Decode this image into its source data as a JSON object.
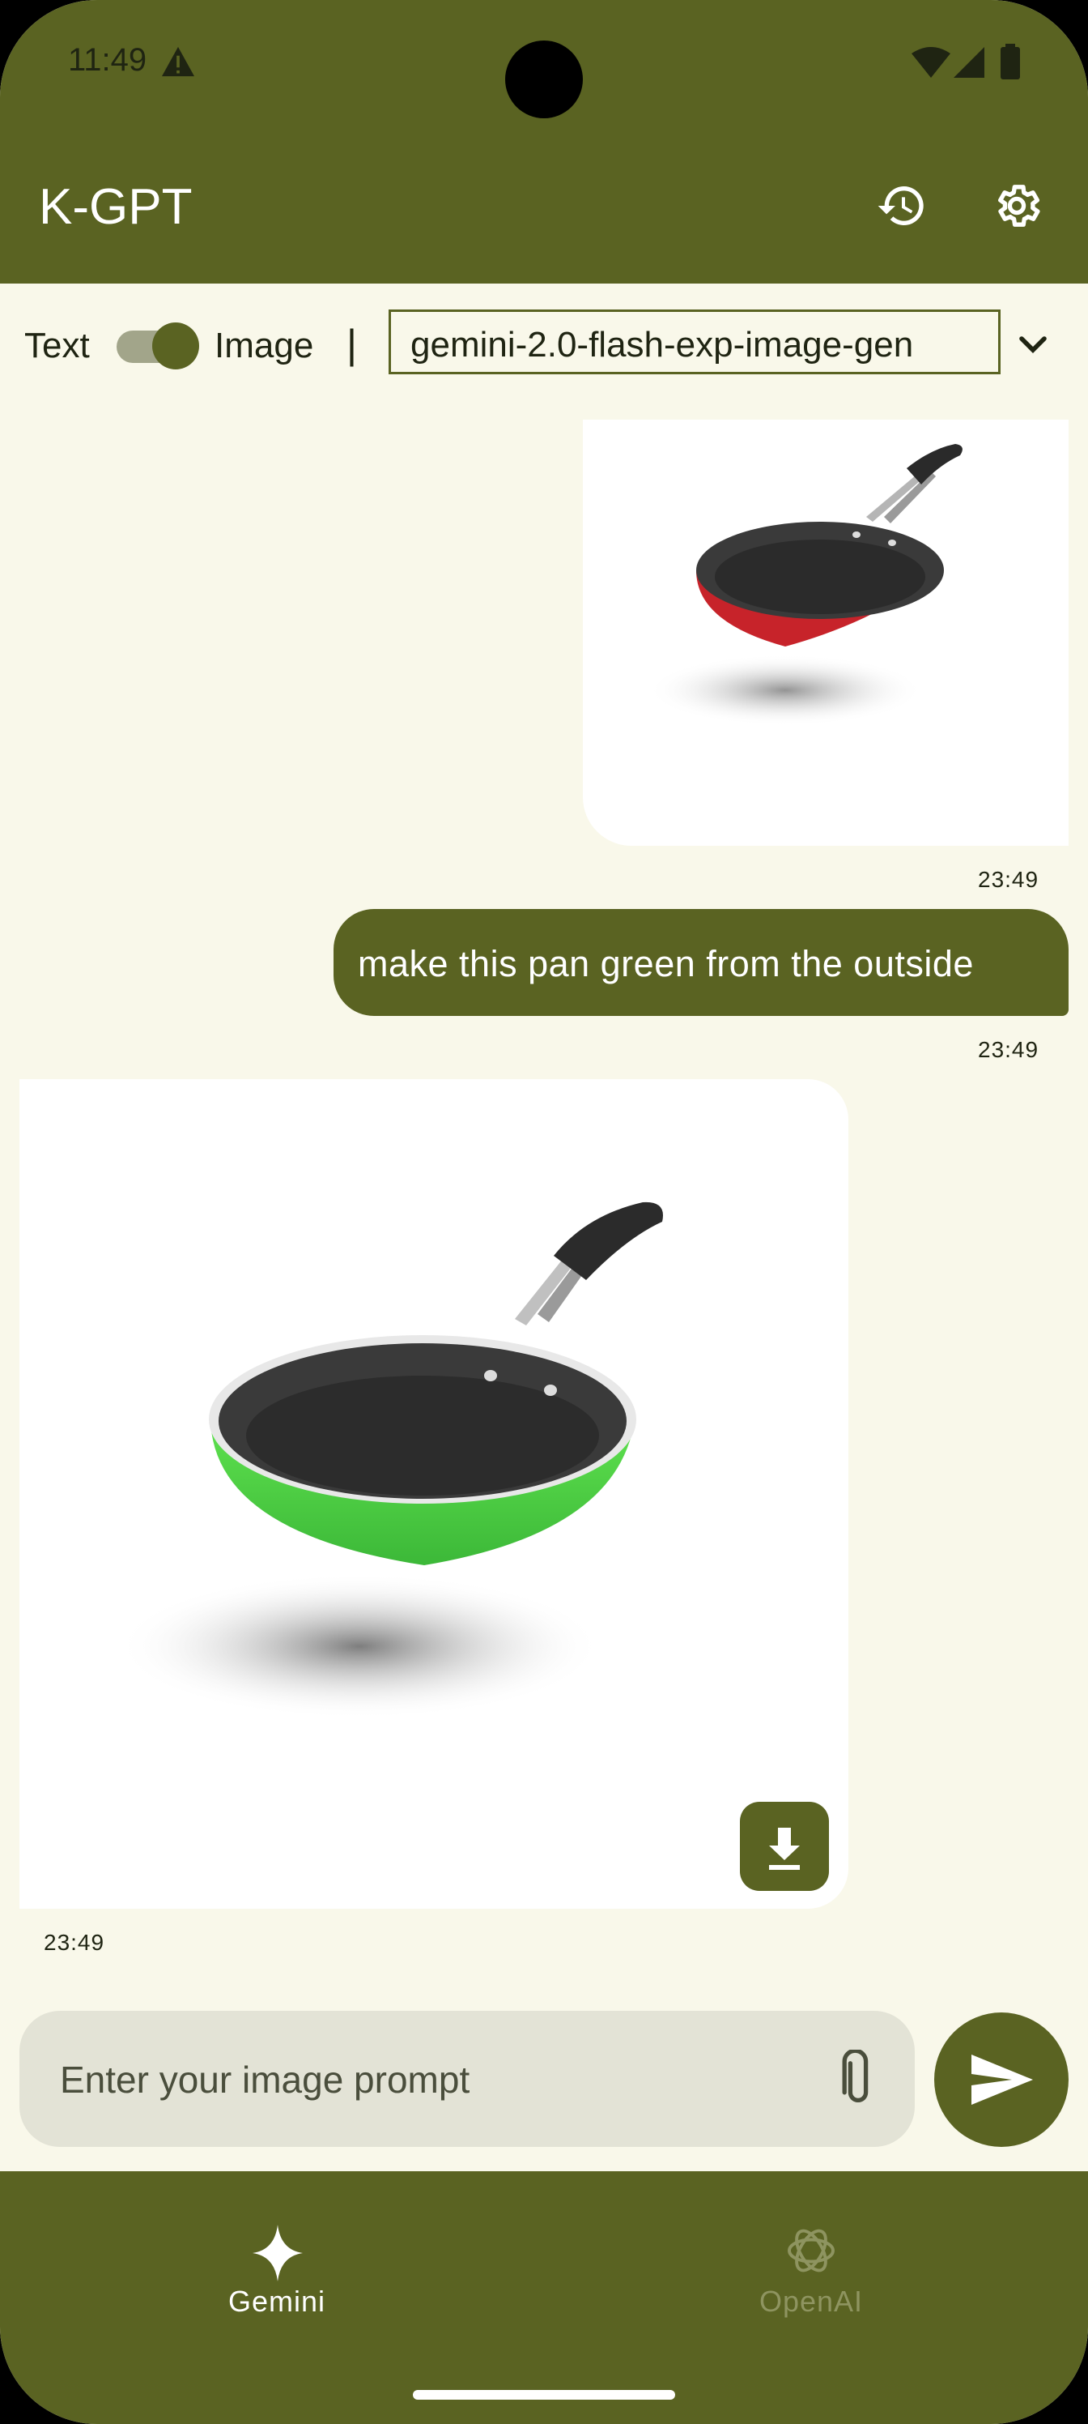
{
  "status": {
    "time": "11:49"
  },
  "app": {
    "title": "K-GPT"
  },
  "mode": {
    "text_label": "Text",
    "image_label": "Image",
    "separator": "|",
    "toggle_state": "image"
  },
  "model": {
    "selected": "gemini-2.0-flash-exp-image-gen"
  },
  "messages": [
    {
      "role": "user",
      "type": "image",
      "description": "red-pan",
      "time": "23:49"
    },
    {
      "role": "user",
      "type": "text",
      "text": "make this pan green from the outside",
      "time": "23:49"
    },
    {
      "role": "model",
      "type": "image",
      "description": "green-pan",
      "time": "23:49"
    }
  ],
  "input": {
    "placeholder": "Enter your image prompt"
  },
  "nav": {
    "items": [
      {
        "label": "Gemini",
        "active": true
      },
      {
        "label": "OpenAI",
        "active": false
      }
    ]
  },
  "colors": {
    "primary": "#5A6322",
    "background": "#F9F8EA",
    "input_bg": "#E3E3D6",
    "inactive_nav": "#8E9460"
  }
}
